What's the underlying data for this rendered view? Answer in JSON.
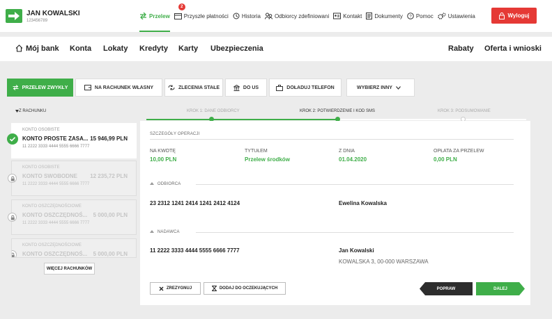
{
  "header": {
    "user_name": "JAN KOWALSKI",
    "user_id": "123456789",
    "nav": [
      {
        "label": "Przelew",
        "icon": "transfer-arrows-icon"
      },
      {
        "label": "Przyszłe płatności",
        "icon": "calendar-icon",
        "badge": "2"
      },
      {
        "label": "Historia",
        "icon": "history-icon"
      },
      {
        "label": "Odbiorcy zdefiniowani",
        "icon": "people-icon"
      },
      {
        "label": "Kontakt",
        "icon": "contact-icon"
      },
      {
        "label": "Dokumenty",
        "icon": "document-icon"
      },
      {
        "label": "Pomoc",
        "icon": "help-icon"
      },
      {
        "label": "Ustawienia",
        "icon": "gear-icon"
      }
    ],
    "logout_label": "Wyloguj",
    "accent": "#3fae49",
    "danger": "#e53935"
  },
  "main_menu": {
    "items": [
      "Mój bank",
      "Konta",
      "Lokaty",
      "Kredyty",
      "Karty",
      "Ubezpieczenia"
    ],
    "right_items": [
      "Rabaty",
      "Oferta i wnioski"
    ]
  },
  "transfer_tabs": [
    {
      "label": "PRZELEW ZWYKŁY",
      "icon": "transfer-arrows-icon",
      "active": true
    },
    {
      "label": "NA RACHUNEK WŁASNY",
      "icon": "wallet-icon"
    },
    {
      "label": "ZLECENIA STAŁE",
      "icon": "recurring-icon"
    },
    {
      "label": "DO US",
      "icon": "building-icon"
    },
    {
      "label": "DOŁADUJ TELEFON",
      "icon": "briefcase-icon"
    },
    {
      "label": "WYBIERZ INNY",
      "icon": "chevron-down-icon"
    }
  ],
  "from_account_label": "Z RACHUNKU",
  "steps": [
    {
      "label": "KROK 1: DANE ODBIORCY",
      "state": "done"
    },
    {
      "label": "KROK 2: POTWIERDZENIE I KOD SMS",
      "state": "current"
    },
    {
      "label": "KROK 3: PODSUMOWANIE",
      "state": "pending"
    }
  ],
  "accounts": [
    {
      "type": "KONTO OSOBISTE",
      "name": "KONTO PROSTE ZASA...",
      "balance": "15 946,99 PLN",
      "number": "11 2222 3333 4444 5555 6666 7777",
      "selected": true
    },
    {
      "type": "KONTO OSOBISTE",
      "name": "KONTO SWOBODNE",
      "balance": "12 235,72 PLN",
      "number": "11 2222 3333 4444 5555 6666 7777"
    },
    {
      "type": "KONTO OSZCZĘDNOŚCIOWE",
      "name": "KONTO OSZCZĘDNOŚ...",
      "balance": "5 000,00 PLN",
      "number": "11 2222 3333 4444 5555 6666 7777"
    },
    {
      "type": "KONTO OSZCZĘDNOŚCIOWE",
      "name": "KONTO OSZCZĘDNOŚ...",
      "balance": "5 000,00 PLN",
      "number": ""
    }
  ],
  "more_accounts_label": "WIĘCEJ RACHUNKÓW",
  "details": {
    "section_operation": "SZCZEGÓŁY OPERACJI",
    "amount_label": "NA KWOTĘ",
    "amount_value": "10,00 PLN",
    "title_label": "TYTUŁEM",
    "title_value": "Przelew środków",
    "date_label": "Z DNIA",
    "date_value": "01.04.2020",
    "fee_label": "OPŁATA ZA PRZELEW",
    "fee_value": "0,00 PLN",
    "section_recipient": "ODBIORCA",
    "recipient_account": "23 2312 1241 2414 1241 2412 4124",
    "recipient_name": "Ewelina Kowalska",
    "section_sender": "NADAWCA",
    "sender_account": "11 2222 3333 4444 5555 6666 7777",
    "sender_name": "Jan Kowalski",
    "sender_address": "KOWALSKA 3, 00-000 WARSZAWA"
  },
  "actions": {
    "cancel_label": "ZREZYGNUJ",
    "pending_label": "DODAJ DO OCZEKUJĄCYCH",
    "back_label": "POPRAW",
    "next_label": "DALEJ"
  }
}
